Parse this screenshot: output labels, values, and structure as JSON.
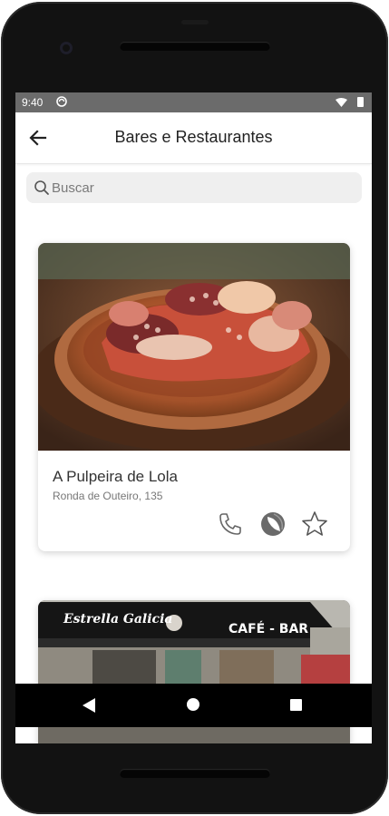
{
  "status_bar": {
    "time": "9:40"
  },
  "app_bar": {
    "title": "Bares e Restaurantes"
  },
  "search": {
    "placeholder": "Buscar",
    "value": ""
  },
  "restaurants": [
    {
      "name": "A Pulpeira de Lola",
      "address": "Ronda de Outeiro, 135"
    },
    {
      "sign_brand": "Estrella Galicia",
      "sign_type": "CAFÉ - BAR"
    }
  ],
  "actions": [
    "phone-icon",
    "map-icon",
    "star-icon"
  ],
  "colors": {
    "statusbar": "#6b6b6b",
    "icon": "#666666",
    "search_bg": "#efefef"
  }
}
